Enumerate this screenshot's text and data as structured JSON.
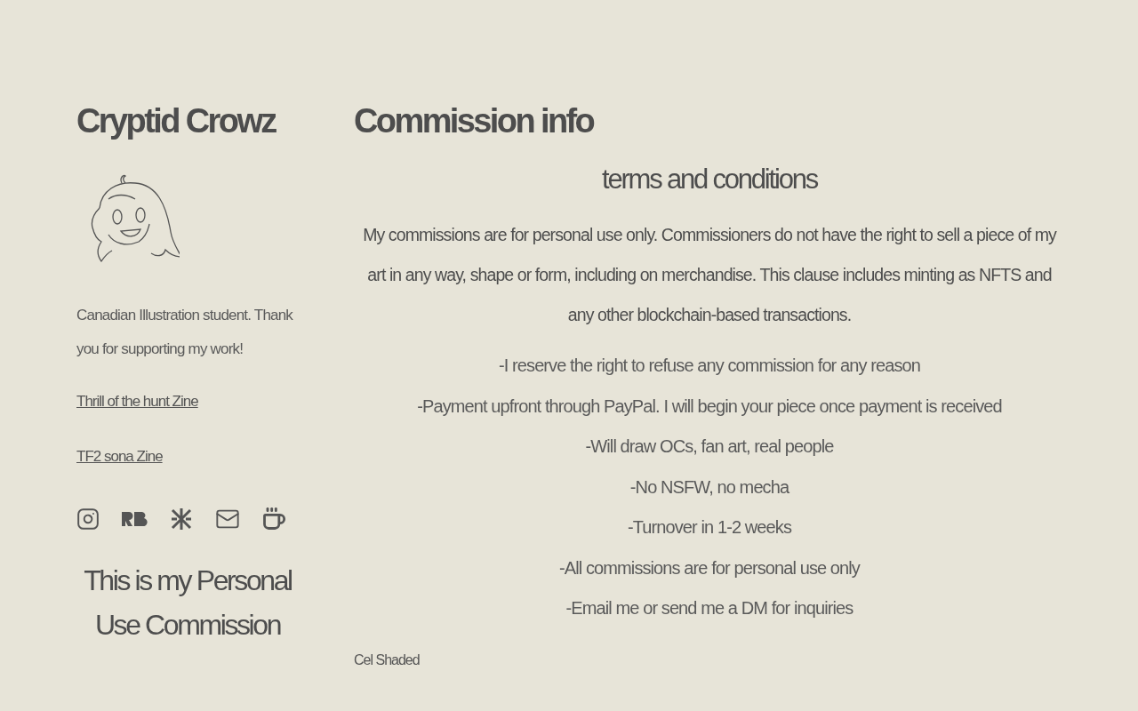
{
  "sidebar": {
    "site_title": "Cryptid Crowz",
    "bio": "Canadian Illustration student. Thank you for supporting my work!",
    "links": [
      "Thrill of the hunt Zine",
      "TF2 sona Zine"
    ],
    "social_icons": [
      {
        "kind": "instagram"
      },
      {
        "kind": "rb"
      },
      {
        "kind": "cross"
      },
      {
        "kind": "mail"
      },
      {
        "kind": "cup"
      }
    ],
    "promo_heading": "This is my Personal Use Commission"
  },
  "main": {
    "title": "Commission info",
    "subtitle": "terms and conditions",
    "notice": "My commissions are for personal use only. Commissioners do not have the right to sell a piece of my art in any way, shape or form, including on merchandise. This clause includes minting as NFTS and any other blockchain-based transactions.",
    "rules": [
      "-I reserve the right to refuse any commission for any reason",
      "-Payment upfront through PayPal. I will begin your piece once payment is received",
      "-Will draw OCs, fan art, real people",
      "-No NSFW, no mecha",
      "-Turnover in 1-2 weeks",
      "-All commissions are for personal use only",
      "-Email me or send me a DM for inquiries"
    ],
    "section_label": "Cel Shaded"
  }
}
